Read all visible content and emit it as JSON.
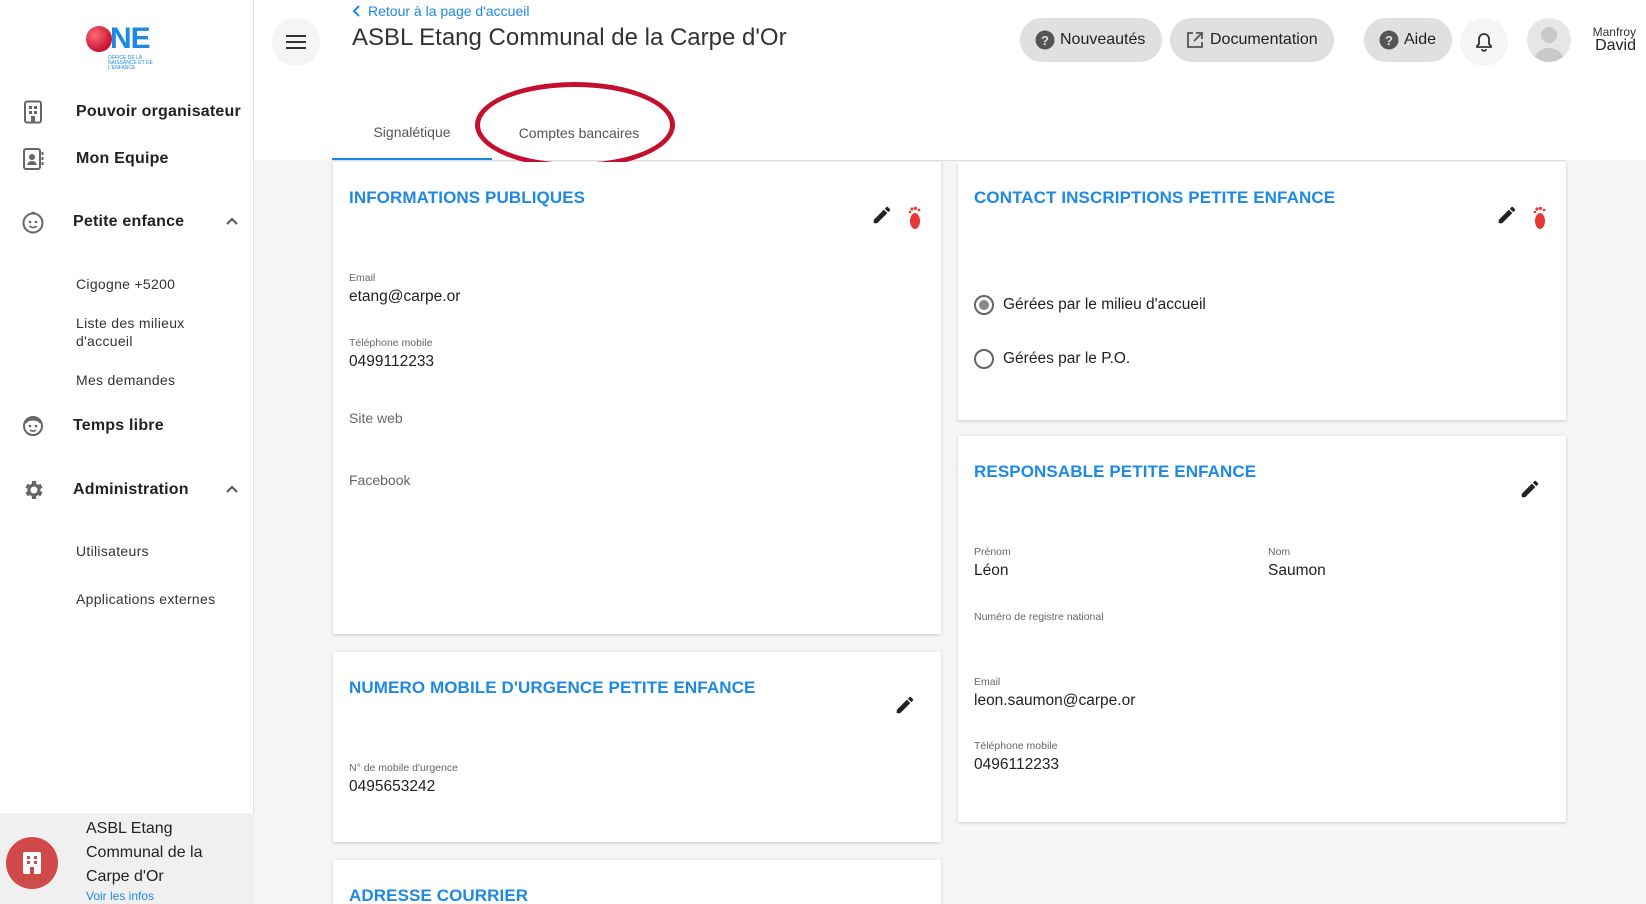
{
  "brand": {
    "logo_text": "NE",
    "logo_sub": "OFFICE DE LA NAISSANCE ET DE L'ENFANCE"
  },
  "sidebar": {
    "items": [
      {
        "label": "Pouvoir organisateur",
        "icon": "building-icon"
      },
      {
        "label": "Mon Equipe",
        "icon": "contact-card-icon"
      },
      {
        "label": "Petite enfance",
        "icon": "baby-face-icon",
        "expanded": true,
        "children": [
          "Cigogne +5200",
          "Liste des milieux d'accueil",
          "Mes demandes"
        ]
      },
      {
        "label": "Temps libre",
        "icon": "child-face-icon"
      },
      {
        "label": "Administration",
        "icon": "gear-icon",
        "expanded": true,
        "children": [
          "Utilisateurs",
          "Applications externes"
        ]
      }
    ],
    "org": {
      "name": "ASBL Etang Communal de la Carpe d'Or",
      "link": "Voir les infos"
    }
  },
  "header": {
    "back_label": "Retour à la page d'accueil",
    "title": "ASBL Etang Communal de la Carpe d'Or",
    "buttons": {
      "news": "Nouveautés",
      "docs": "Documentation",
      "help": "Aide"
    },
    "user": {
      "first": "Manfroy",
      "last": "David"
    }
  },
  "tabs": {
    "active": "Signalétique",
    "other": "Comptes bancaires"
  },
  "colors": {
    "accent": "#1e88e5",
    "annotation": "#c4102e",
    "foot": "#e53935"
  },
  "cards": {
    "public_info": {
      "title": "INFORMATIONS PUBLIQUES",
      "email_label": "Email",
      "email": "etang@carpe.or",
      "phone_label": "Téléphone mobile",
      "phone": "0499112233",
      "web_label": "Site web",
      "facebook_label": "Facebook"
    },
    "urgence": {
      "title": "NUMERO MOBILE D'URGENCE PETITE ENFANCE",
      "label": "N° de mobile d'urgence",
      "value": "0495653242"
    },
    "adresse": {
      "title": "ADRESSE COURRIER"
    },
    "contact": {
      "title": "CONTACT INSCRIPTIONS PETITE ENFANCE",
      "option1": "Gérées par le milieu d'accueil",
      "option2": "Gérées par le P.O.",
      "selected": 1
    },
    "responsable": {
      "title": "RESPONSABLE PETITE ENFANCE",
      "prenom_label": "Prénom",
      "prenom": "Léon",
      "nom_label": "Nom",
      "nom": "Saumon",
      "registre_label": "Numéro de registre national",
      "email_label": "Email",
      "email": "leon.saumon@carpe.or",
      "phone_label": "Téléphone mobile",
      "phone": "0496112233"
    }
  }
}
